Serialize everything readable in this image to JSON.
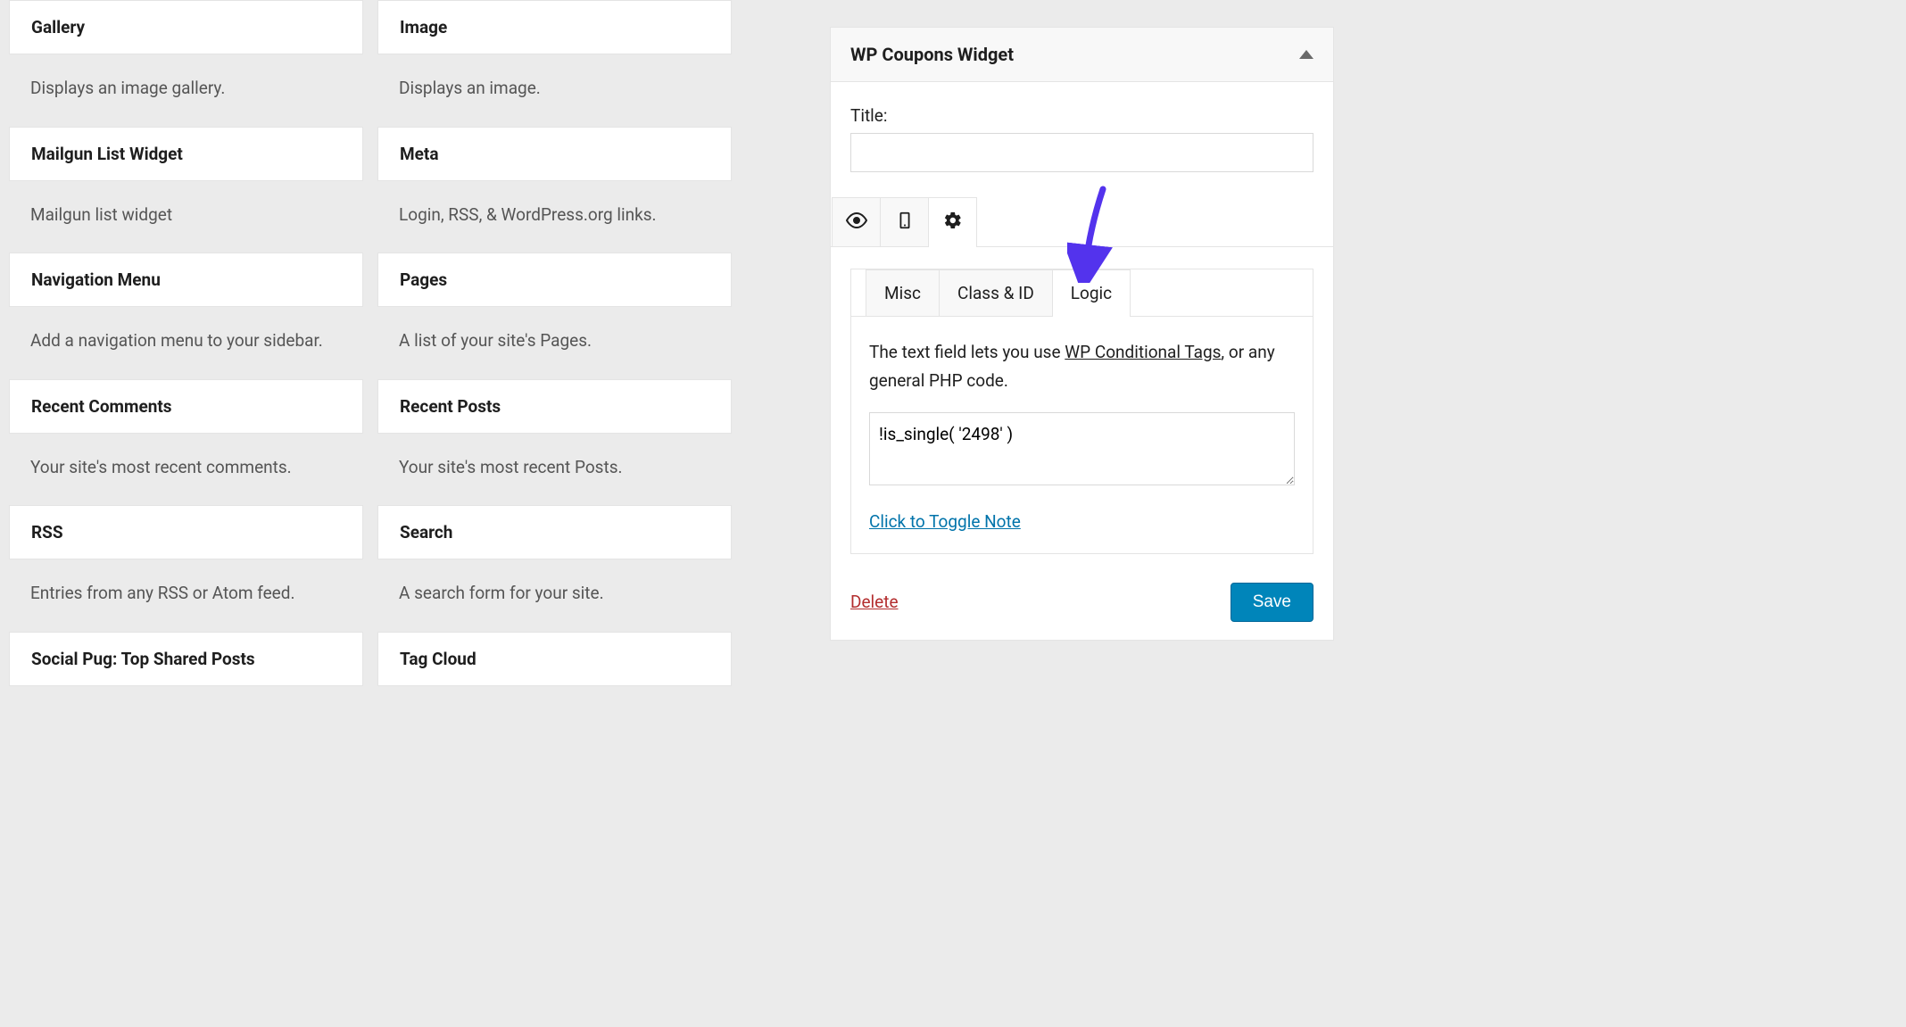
{
  "available_widgets": {
    "col1": [
      {
        "title": "Gallery",
        "desc": "Displays an image gallery."
      },
      {
        "title": "Mailgun List Widget",
        "desc": "Mailgun list widget"
      },
      {
        "title": "Navigation Menu",
        "desc": "Add a navigation menu to your sidebar."
      },
      {
        "title": "Recent Comments",
        "desc": "Your site's most recent comments."
      },
      {
        "title": "RSS",
        "desc": "Entries from any RSS or Atom feed."
      },
      {
        "title": "Social Pug: Top Shared Posts",
        "desc": ""
      }
    ],
    "col2": [
      {
        "title": "Image",
        "desc": "Displays an image."
      },
      {
        "title": "Meta",
        "desc": "Login, RSS, & WordPress.org links."
      },
      {
        "title": "Pages",
        "desc": "A list of your site's Pages."
      },
      {
        "title": "Recent Posts",
        "desc": "Your site's most recent Posts."
      },
      {
        "title": "Search",
        "desc": "A search form for your site."
      },
      {
        "title": "Tag Cloud",
        "desc": ""
      }
    ]
  },
  "panel": {
    "title": "WP Coupons Widget",
    "title_label": "Title:",
    "title_value": "",
    "sub_tabs": {
      "misc": "Misc",
      "classid": "Class & ID",
      "logic": "Logic"
    },
    "help_pre": "The text field lets you use ",
    "help_link": "WP Conditional Tags",
    "help_post": ", or any general PHP code.",
    "logic_value": "!is_single( '2498' )",
    "toggle_note": "Click to Toggle Note",
    "delete": "Delete",
    "save": "Save"
  },
  "colors": {
    "accent_arrow": "#5333ed"
  }
}
